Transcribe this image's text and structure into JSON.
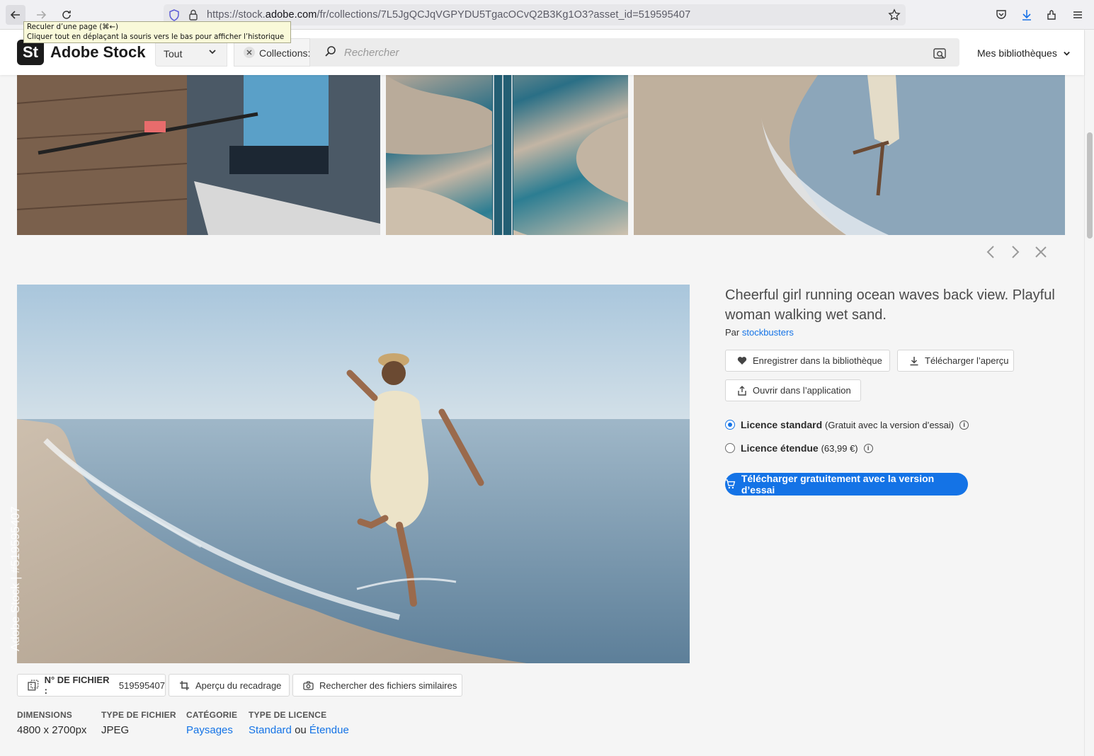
{
  "browser": {
    "url_prefix": "https://stock.",
    "url_host": "adobe.com",
    "url_path": "/fr/collections/7L5JgQCJqVGPYDU5TgacOCvQ2B3Kg1O3?asset_id=519595407",
    "tooltip_line1": "Reculer d’une page (⌘←)",
    "tooltip_line2": "Cliquer tout en déplaçant la souris vers le bas pour afficher l’historique"
  },
  "header": {
    "logo_mark": "St",
    "logo_text": "Adobe Stock",
    "filter_value": "Tout",
    "collection_chip": "Collections:",
    "search_placeholder": "Rechercher",
    "libraries_label": "Mes bibliothèques"
  },
  "asset": {
    "title": "Cheerful girl running ocean waves back view. Playful woman walking wet sand.",
    "author_prefix": "Par",
    "author_name": "stockbusters",
    "side_watermark": "Adobe Stock | #519595407",
    "actions": {
      "save_library": "Enregistrer dans la bibliothèque",
      "download_preview": "Télécharger l’aperçu",
      "open_app": "Ouvrir dans l’application"
    },
    "licenses": [
      {
        "name": "Licence standard",
        "detail": "(Gratuit avec la version d’essai)",
        "selected": true
      },
      {
        "name": "Licence étendue",
        "detail": "(63,99 €)",
        "selected": false
      }
    ],
    "cta_label": "Télécharger gratuitement avec la version d’essai"
  },
  "meta": {
    "file_number_label": "N° DE FICHIER :",
    "file_number": "519595407",
    "crop_preview": "Aperçu du recadrage",
    "find_similar": "Rechercher des fichiers similaires",
    "specs": [
      {
        "label": "DIMENSIONS",
        "value": "4800 x 2700px"
      },
      {
        "label": "TYPE DE FICHIER",
        "value": "JPEG"
      },
      {
        "label": "CATÉGORIE",
        "value": "Paysages"
      },
      {
        "label": "TYPE DE LICENCE",
        "value_a": "Standard",
        "value_sep": "ou",
        "value_b": "Étendue"
      }
    ]
  },
  "colors": {
    "accent": "#1473e6",
    "header_bg": "#ffffff",
    "page_bg": "#f5f5f5"
  }
}
